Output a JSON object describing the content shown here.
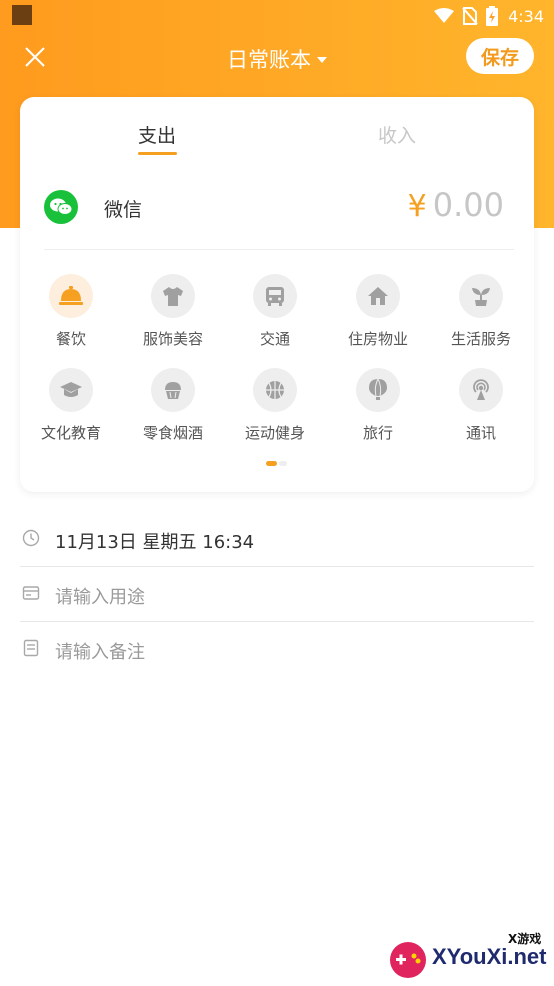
{
  "status_bar": {
    "time": "4:34"
  },
  "header": {
    "title": "日常账本",
    "save_label": "保存"
  },
  "tabs": {
    "expense": "支出",
    "income": "收入"
  },
  "account": {
    "name": "微信",
    "currency": "¥",
    "amount": "0.00"
  },
  "categories": [
    {
      "label": "餐饮",
      "icon": "dining-bell-icon"
    },
    {
      "label": "服饰美容",
      "icon": "shirt-icon"
    },
    {
      "label": "交通",
      "icon": "bus-icon"
    },
    {
      "label": "住房物业",
      "icon": "house-icon"
    },
    {
      "label": "生活服务",
      "icon": "sprout-icon"
    },
    {
      "label": "文化教育",
      "icon": "graduation-cap-icon"
    },
    {
      "label": "零食烟酒",
      "icon": "cupcake-icon"
    },
    {
      "label": "运动健身",
      "icon": "basketball-icon"
    },
    {
      "label": "旅行",
      "icon": "hot-air-balloon-icon"
    },
    {
      "label": "通讯",
      "icon": "signal-tower-icon"
    }
  ],
  "form": {
    "datetime": "11月13日 星期五 16:34",
    "purpose_placeholder": "请输入用途",
    "note_placeholder": "请输入备注"
  },
  "watermark": {
    "text": "XYouXi.net",
    "small": "X游戏"
  },
  "colors": {
    "accent": "#f5a020",
    "header_start": "#ff9b1e",
    "header_end": "#ffb52c",
    "wechat": "#19c13b"
  }
}
